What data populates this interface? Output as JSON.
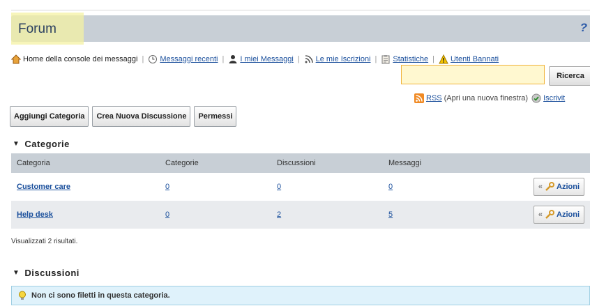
{
  "header": {
    "title": "Forum",
    "help_icon": "help-icon"
  },
  "nav": {
    "home": "Home della console dei messaggi",
    "recent": "Messaggi recenti",
    "my_messages": "I miei Messaggi",
    "subscriptions": "Le mie Iscrizioni",
    "statistics": "Statistiche",
    "banned": "Utenti Bannati"
  },
  "search": {
    "value": "",
    "button": "Ricerca"
  },
  "rss": {
    "label": "RSS",
    "note": "(Apri una nuova finestra)",
    "subscribe": "Iscrivit"
  },
  "toolbar": {
    "add_category": "Aggiungi Categoria",
    "new_thread": "Crea Nuova Discussione",
    "permissions": "Permessi"
  },
  "categories": {
    "heading": "Categorie",
    "columns": [
      "Categoria",
      "Categorie",
      "Discussioni",
      "Messaggi"
    ],
    "rows": [
      {
        "name": "Customer care",
        "categories": "0",
        "threads": "0",
        "messages": "0",
        "action": "Azioni"
      },
      {
        "name": "Help desk",
        "categories": "0",
        "threads": "2",
        "messages": "5",
        "action": "Azioni"
      }
    ],
    "results": "Visualizzati 2 risultati."
  },
  "threads": {
    "heading": "Discussioni",
    "empty_message": "Non ci sono filetti in questa categoria."
  }
}
